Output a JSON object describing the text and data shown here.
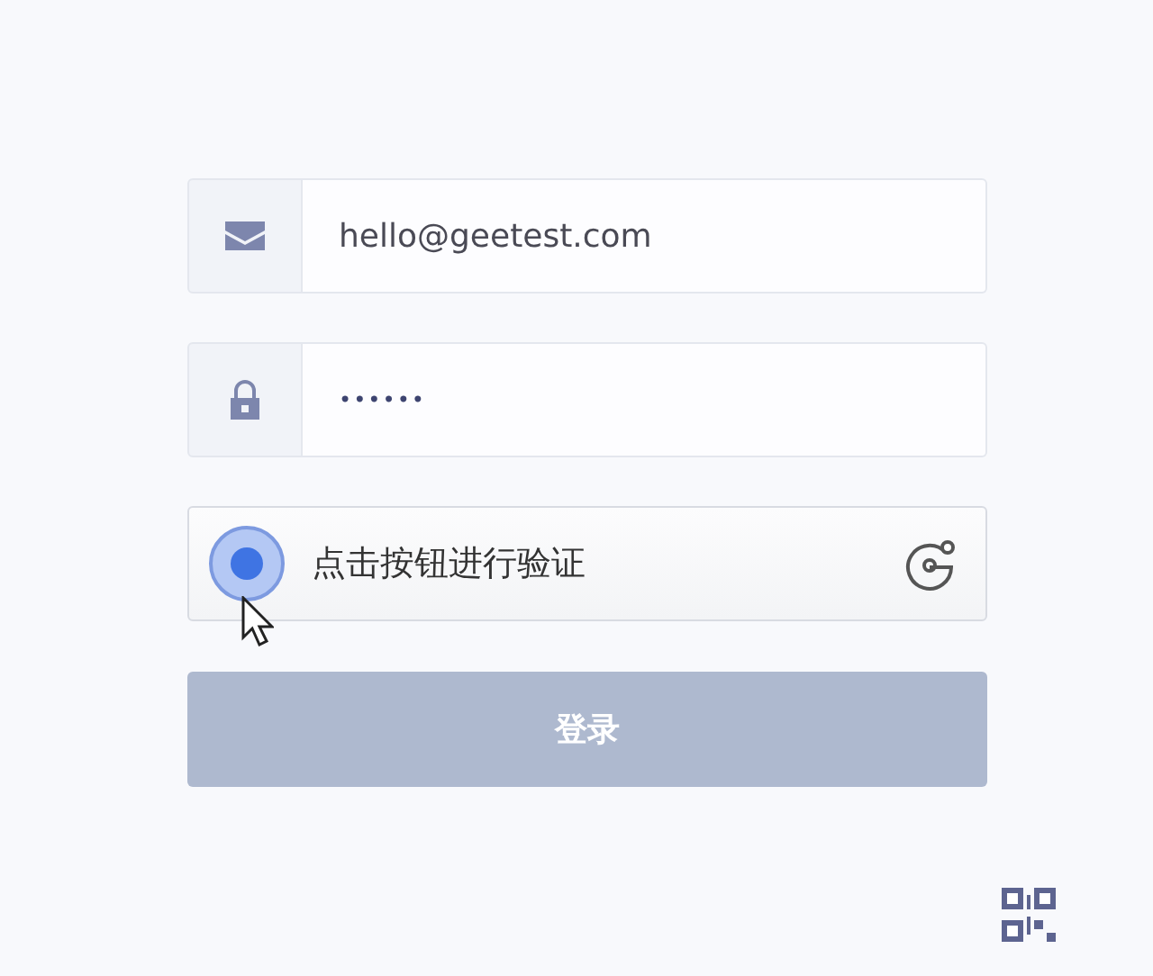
{
  "email_field": {
    "value": "hello@geetest.com"
  },
  "password_field": {
    "value": "••••••"
  },
  "captcha": {
    "label": "点击按钮进行验证"
  },
  "login_button": {
    "label": "登录",
    "disabled": true
  }
}
